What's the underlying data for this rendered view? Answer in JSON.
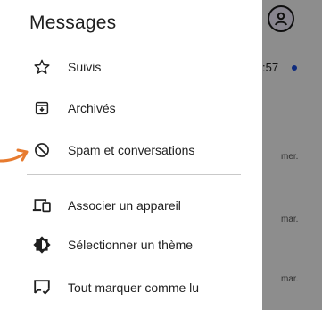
{
  "drawer": {
    "title": "Messages",
    "items": [
      {
        "label": "Suivis",
        "icon": "star-outline-icon"
      },
      {
        "label": "Archivés",
        "icon": "archive-icon"
      },
      {
        "label": "Spam et conversations",
        "icon": "block-icon"
      },
      {
        "label": "Associer un appareil",
        "icon": "devices-icon"
      },
      {
        "label": "Sélectionner un thème",
        "icon": "theme-icon"
      },
      {
        "label": "Tout marquer comme lu",
        "icon": "mark-read-icon"
      }
    ]
  },
  "background": {
    "time": ":57",
    "dates": [
      "mer.",
      "mar.",
      "mar."
    ]
  },
  "colors": {
    "text": "#1f1f1f",
    "scrim": "rgba(0,0,0,0.42)",
    "annotation_arrow": "#e77b2f",
    "unread_dot": "#1b4bd8"
  }
}
